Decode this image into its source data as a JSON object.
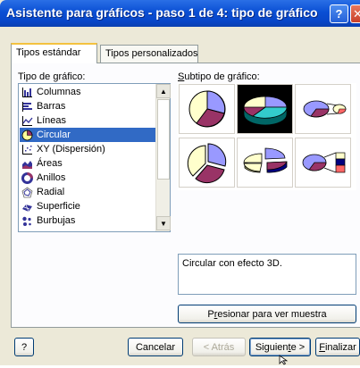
{
  "window": {
    "title": "Asistente para gráficos - paso 1 de 4: tipo de gráfico",
    "help_glyph": "?",
    "close_glyph": "✕"
  },
  "tabs": [
    {
      "label": "Tipos estándar",
      "active": true
    },
    {
      "label": "Tipos personalizados",
      "active": false
    }
  ],
  "chart_type": {
    "label_prefix": "Tipo de ",
    "label_accel": "g",
    "label_suffix": "ráfico:",
    "selected_index": 3,
    "items": [
      {
        "label": "Columnas",
        "icon": "column-chart-icon"
      },
      {
        "label": "Barras",
        "icon": "bar-chart-icon"
      },
      {
        "label": "Líneas",
        "icon": "line-chart-icon"
      },
      {
        "label": "Circular",
        "icon": "pie-chart-icon"
      },
      {
        "label": "XY (Dispersión)",
        "icon": "scatter-chart-icon"
      },
      {
        "label": "Áreas",
        "icon": "area-chart-icon"
      },
      {
        "label": "Anillos",
        "icon": "doughnut-chart-icon"
      },
      {
        "label": "Radial",
        "icon": "radar-chart-icon"
      },
      {
        "label": "Superficie",
        "icon": "surface-chart-icon"
      },
      {
        "label": "Burbujas",
        "icon": "bubble-chart-icon"
      }
    ]
  },
  "subtype": {
    "label_accel": "S",
    "label_suffix": "ubtipo de gráfico:",
    "selected_index": 1,
    "items": [
      {
        "icon": "pie-subtype-icon"
      },
      {
        "icon": "pie-3d-subtype-icon"
      },
      {
        "icon": "pie-of-pie-subtype-icon"
      },
      {
        "icon": "exploded-pie-subtype-icon"
      },
      {
        "icon": "exploded-pie-3d-subtype-icon"
      },
      {
        "icon": "bar-of-pie-subtype-icon"
      }
    ],
    "description": "Circular con efecto 3D."
  },
  "buttons": {
    "preview": {
      "prefix": "P",
      "accel": "r",
      "suffix": "esionar para ver muestra"
    },
    "help": "?",
    "cancel": "Cancelar",
    "back": "< Atrás",
    "next_prefix": "Siguien",
    "next_accel": "t",
    "next_suffix": "e >",
    "finish_accel": "F",
    "finish_suffix": "inalizar"
  },
  "colors": {
    "pie_lavender": "#9999ff",
    "pie_plum": "#993366",
    "pie_cream": "#ffffcc",
    "pie_teal": "#33cccc",
    "pie_navy": "#000080",
    "selection": "#316ac5"
  }
}
